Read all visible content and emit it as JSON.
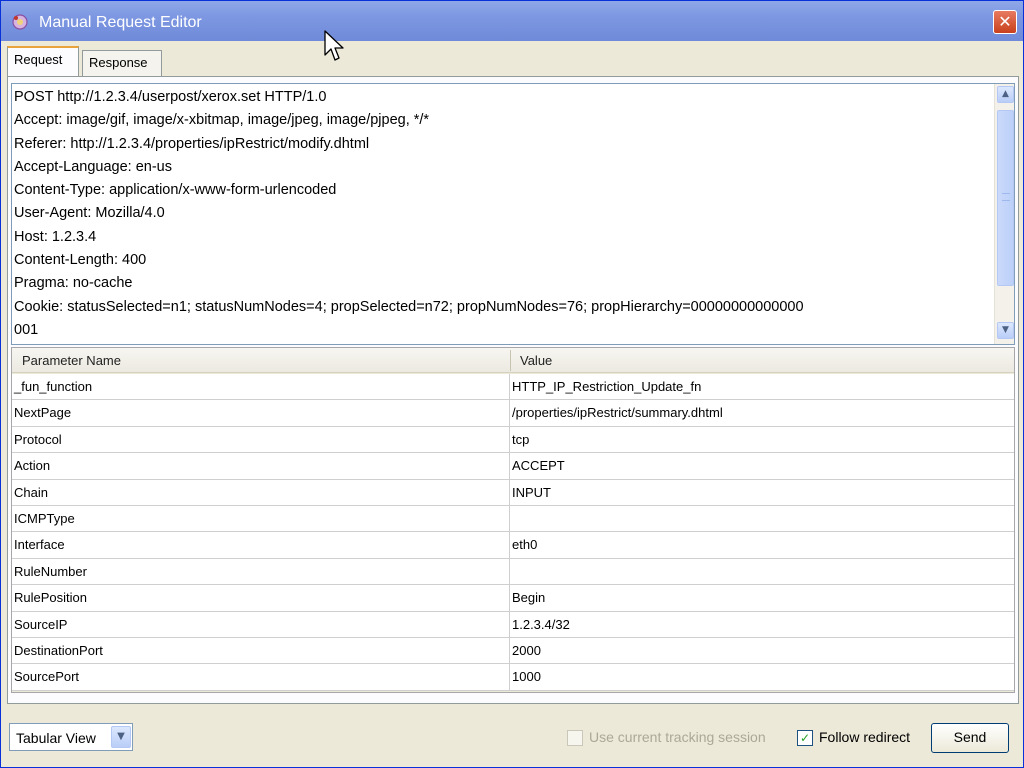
{
  "window": {
    "title": "Manual Request Editor",
    "close_glyph": "✕"
  },
  "tabs": [
    {
      "label": "Request",
      "active": true
    },
    {
      "label": "Response",
      "active": false
    }
  ],
  "request_text": "POST http://1.2.3.4/userpost/xerox.set HTTP/1.0\nAccept: image/gif, image/x-xbitmap, image/jpeg, image/pjpeg, */*\nReferer: http://1.2.3.4/properties/ipRestrict/modify.dhtml\nAccept-Language: en-us\nContent-Type: application/x-www-form-urlencoded\nUser-Agent: Mozilla/4.0\nHost: 1.2.3.4\nContent-Length: 400\nPragma: no-cache\nCookie: statusSelected=n1; statusNumNodes=4; propSelected=n72; propNumNodes=76; propHierarchy=00000000000000\n001",
  "scrollbar": {
    "up_glyph": "▲",
    "down_glyph": "▼"
  },
  "table": {
    "headers": {
      "name": "Parameter Name",
      "value": "Value"
    },
    "rows": [
      {
        "name": "_fun_function",
        "value": "HTTP_IP_Restriction_Update_fn"
      },
      {
        "name": "NextPage",
        "value": "/properties/ipRestrict/summary.dhtml"
      },
      {
        "name": "Protocol",
        "value": "tcp"
      },
      {
        "name": "Action",
        "value": "ACCEPT"
      },
      {
        "name": "Chain",
        "value": "INPUT"
      },
      {
        "name": "ICMPType",
        "value": ""
      },
      {
        "name": "Interface",
        "value": "eth0"
      },
      {
        "name": "RuleNumber",
        "value": ""
      },
      {
        "name": "RulePosition",
        "value": "Begin"
      },
      {
        "name": "SourceIP",
        "value": "1.2.3.4/32"
      },
      {
        "name": "DestinationPort",
        "value": "2000"
      },
      {
        "name": "SourcePort",
        "value": "1000"
      }
    ]
  },
  "bottom": {
    "view_select": "Tabular View",
    "dropdown_glyph": "▼",
    "use_tracking_label": "Use current tracking session",
    "use_tracking_checked": false,
    "follow_redirect_label": "Follow redirect",
    "follow_redirect_checked": true,
    "check_glyph": "✓",
    "send_label": "Send"
  }
}
